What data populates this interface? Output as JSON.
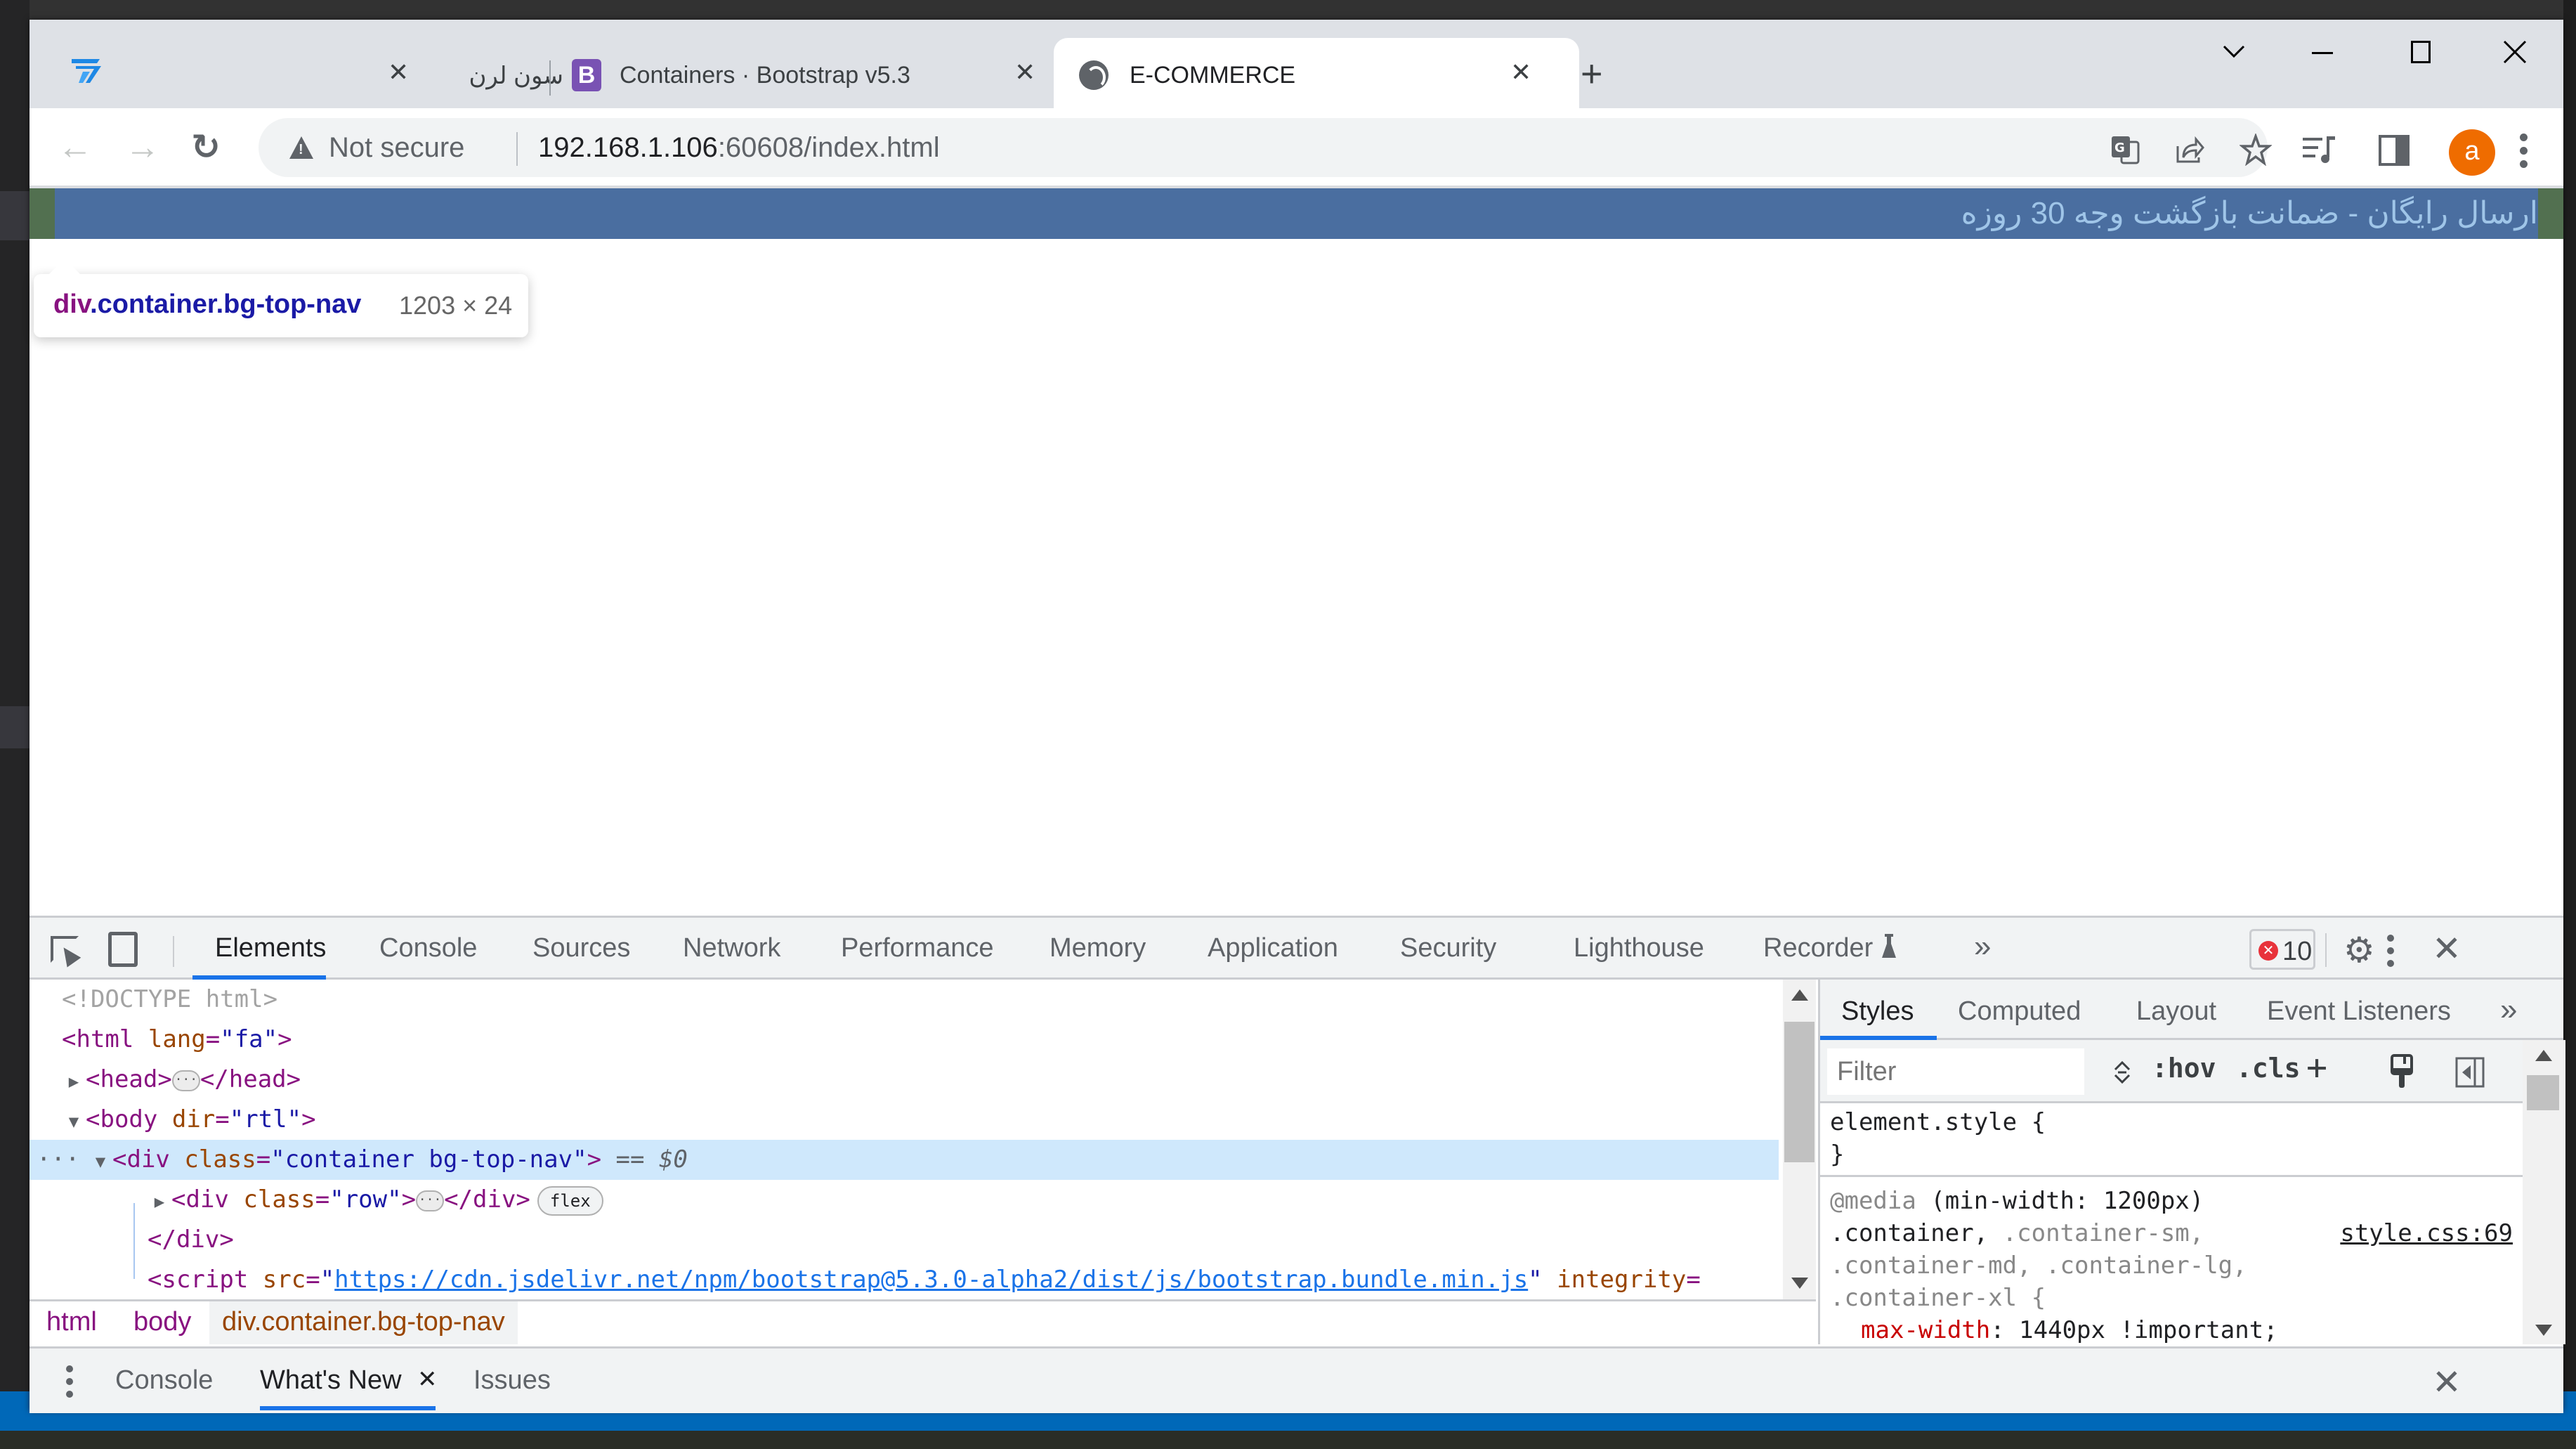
{
  "browser": {
    "tabs": [
      {
        "title": "سون لرن",
        "favicon": "sevenlearn-icon",
        "active": false
      },
      {
        "title": "Containers · Bootstrap v5.3",
        "favicon": "bootstrap-icon",
        "favicon_letter": "B",
        "active": false
      },
      {
        "title": "E-COMMERCE",
        "favicon": "globe-icon",
        "active": true
      }
    ],
    "new_tab_symbol": "+",
    "tab_close_symbol": "✕",
    "window_controls": {
      "tab_search": "⌄",
      "minimize": "—",
      "maximize": "☐",
      "close": "✕"
    },
    "toolbar": {
      "back": "←",
      "forward": "→",
      "reload": "↻",
      "security_label": "Not secure",
      "url_host": "192.168.1.106",
      "url_rest": ":60608/index.html",
      "omnibox_icons": [
        "translate-icon",
        "share-icon",
        "bookmark-star-icon"
      ],
      "extension_icons": [
        "media-queue-icon",
        "side-panel-icon"
      ],
      "profile_initial": "a",
      "profile_color": "#ef6c00"
    }
  },
  "page": {
    "top_nav_text": "ارسال رایگان - ضمانت بازگشت وجه 30 روزه",
    "top_nav_bg": "#4a6ea0",
    "top_nav_text_color": "#9fc5e8",
    "inspect_tooltip": {
      "element": "div",
      "classes": ".container.bg-top-nav",
      "size": "1203 × 24"
    }
  },
  "devtools": {
    "tabs": [
      "Elements",
      "Console",
      "Sources",
      "Network",
      "Performance",
      "Memory",
      "Application",
      "Security",
      "Lighthouse",
      "Recorder"
    ],
    "active_tab": "Elements",
    "more_tabs": "»",
    "error_count": "10",
    "elements_tree": {
      "doctype": "<!DOCTYPE html>",
      "html_open": {
        "tag": "<html",
        "attr": "lang",
        "value": "\"fa\"",
        "close": ">"
      },
      "head": {
        "open": "<head>",
        "close": "</head>"
      },
      "body_open": {
        "tag": "<body",
        "attr": "dir",
        "value": "\"rtl\"",
        "close": ">"
      },
      "selected_div": {
        "tag": "<div",
        "attr": "class",
        "value": "\"container bg-top-nav\"",
        "close": ">",
        "eq": "== $0"
      },
      "row_div": {
        "tag": "<div",
        "attr": "class",
        "value": "\"row\"",
        "close": ">",
        "end": "</div>",
        "badge": "flex"
      },
      "div_close": "</div>",
      "script": {
        "tag": "<script",
        "attr": "src",
        "url": "https://cdn.jsdelivr.net/npm/bootstrap@5.3.0-alpha2/dist/js/bootstrap.bundle.min.js",
        "next_attr": "integrity"
      }
    },
    "breadcrumbs": [
      "html",
      "body",
      "div.container.bg-top-nav"
    ],
    "styles_pane": {
      "tabs": [
        "Styles",
        "Computed",
        "Layout",
        "Event Listeners"
      ],
      "active_tab": "Styles",
      "more": "»",
      "filter_placeholder": "Filter",
      "buttons": {
        "hov": ":hov",
        "cls": ".cls",
        "add": "+"
      },
      "rules": {
        "element_style_open": "element.style {",
        "element_style_close": "}",
        "media": "@media",
        "media_query": "(min-width: 1200px)",
        "selector_match": ".container,",
        "selector_line1_rest": ".container-sm,",
        "selector_line2": ".container-md, .container-lg,",
        "selector_line3": ".container-xl {",
        "source": "style.css:69",
        "prop_name": "max-width",
        "prop_value": ": 1440px !important;"
      }
    },
    "drawer": {
      "tabs": [
        "Console",
        "What's New",
        "Issues"
      ],
      "active_tab": "What's New"
    }
  }
}
